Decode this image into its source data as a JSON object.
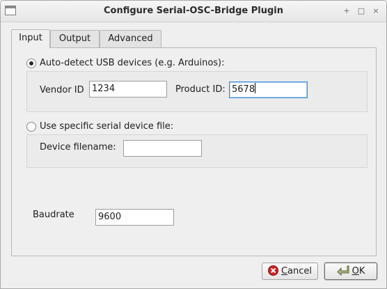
{
  "window": {
    "title": "Configure Serial-OSC-Bridge Plugin",
    "controls": [
      "+",
      "□",
      "×"
    ]
  },
  "tabs": [
    {
      "label": "Input",
      "active": true
    },
    {
      "label": "Output",
      "active": false
    },
    {
      "label": "Advanced",
      "active": false
    }
  ],
  "input": {
    "auto_detect": {
      "label": "Auto-detect USB devices (e.g. Arduinos):",
      "selected": true,
      "vendor_label": "Vendor ID",
      "vendor_value": "1234",
      "product_label": "Product ID:",
      "product_value": "5678"
    },
    "specific_file": {
      "label": "Use specific serial device file:",
      "selected": false,
      "filename_label": "Device filename:",
      "filename_value": ""
    },
    "baudrate": {
      "label": "Baudrate",
      "value": "9600"
    }
  },
  "buttons": {
    "cancel_first": "C",
    "cancel_rest": "ancel",
    "ok_first": "O",
    "ok_rest": "K"
  }
}
